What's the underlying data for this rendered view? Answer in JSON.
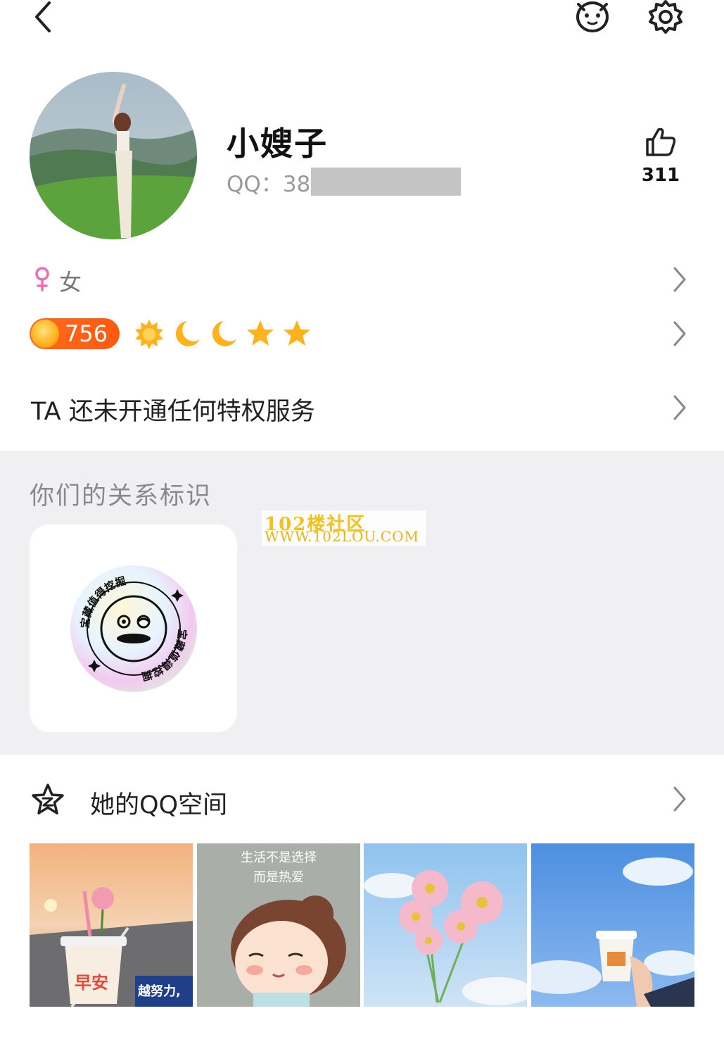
{
  "profile": {
    "nickname": "小嫂子",
    "qq_prefix": "QQ：",
    "qq_partial": "38",
    "likes": "311",
    "gender": "女"
  },
  "level": {
    "value": "756",
    "icons": [
      "sun-icon",
      "moon-icon",
      "moon-icon",
      "star-icon",
      "star-icon"
    ]
  },
  "privilege": {
    "text": "TA 还未开通任何特权服务"
  },
  "relation": {
    "title": "你们的关系标识",
    "badge_text": "宝藏值得挖掘"
  },
  "watermark": {
    "line1": "102楼社区",
    "line2": "WWW.102LOU.COM"
  },
  "qzone": {
    "title": "她的QQ空间",
    "photos": [
      {
        "caption": "早安",
        "caption2": "越努力,"
      },
      {
        "caption": "生活不是选择",
        "caption2": "而是热爱"
      },
      {
        "caption": "",
        "caption2": ""
      },
      {
        "caption": "",
        "caption2": ""
      }
    ]
  },
  "colors": {
    "level_badge": "#ff6a1e",
    "gender_female": "#f06bb0",
    "section_gray": "#f0f0f2",
    "chevron": "#8a8a8a"
  }
}
